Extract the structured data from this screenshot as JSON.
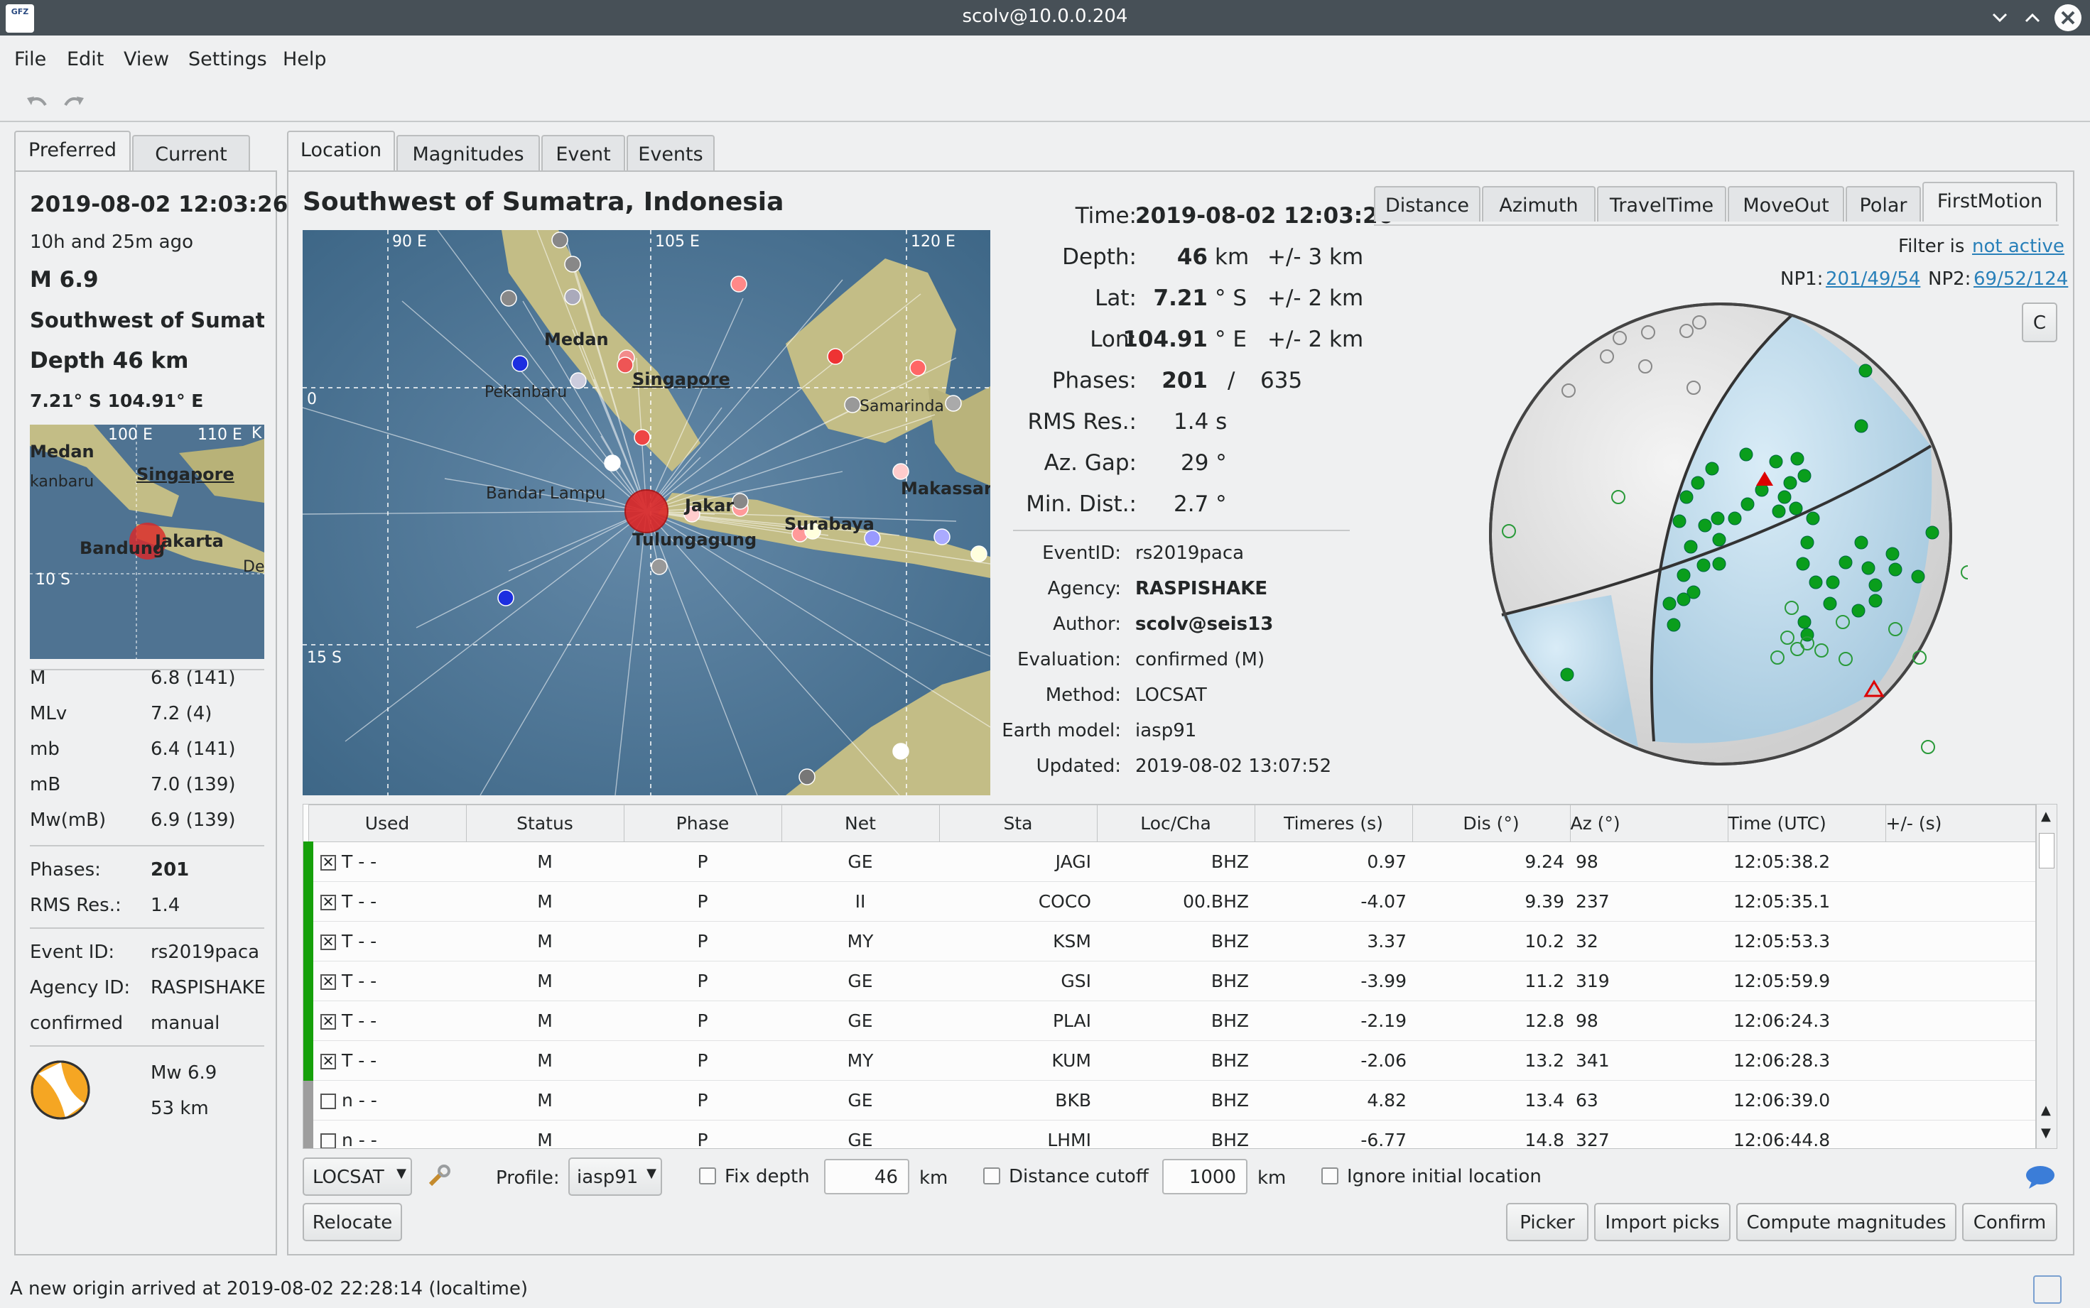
{
  "window": {
    "title": "scolv@10.0.0.204",
    "logo_text": "GFZ"
  },
  "menu": [
    "File",
    "Edit",
    "View",
    "Settings",
    "Help"
  ],
  "left_tabs": [
    "Preferred",
    "Current"
  ],
  "summary": {
    "time": "2019-08-02 12:03:26",
    "ago": "10h and 25m ago",
    "magnitude": "M 6.9",
    "region": "Southwest of Sumat",
    "depth": "Depth 46 km",
    "coords": "7.21° S  104.91° E",
    "map_labels": [
      "Medan",
      "Singapore",
      "kanbaru",
      "Bandung",
      "Jakarta",
      "100 E",
      "110 E",
      "10 S",
      "K",
      "De"
    ],
    "magnitudes": [
      {
        "type": "M",
        "value": "6.8 (141)"
      },
      {
        "type": "MLv",
        "value": "7.2 (4)"
      },
      {
        "type": "mb",
        "value": "6.4 (141)"
      },
      {
        "type": "mB",
        "value": "7.0 (139)"
      },
      {
        "type": "Mw(mB)",
        "value": "6.9 (139)"
      }
    ],
    "phases_label": "Phases:",
    "phases": "201",
    "rms_label": "RMS Res.:",
    "rms": "1.4",
    "event_id_label": "Event ID:",
    "event_id": "rs2019paca",
    "agency_label": "Agency ID:",
    "agency": "RASPISHAKE",
    "status": "confirmed",
    "mode": "manual",
    "mt_mag": "Mw 6.9",
    "mt_depth": "53 km"
  },
  "main_tabs": [
    "Location",
    "Magnitudes",
    "Event",
    "Events"
  ],
  "region_title": "Southwest of Sumatra, Indonesia",
  "map": {
    "labels": [
      "90 E",
      "105 E",
      "120 E",
      "0",
      "15 S",
      "Medan",
      "Pekanbaru",
      "Singapore",
      "Samarinda",
      "Makassar",
      "Bandar Lampu",
      "Jakar",
      "Tulungagung",
      "Surabaya"
    ]
  },
  "origin": {
    "time_label": "Time:",
    "time": "2019-08-02 12:03:26",
    "depth_label": "Depth:",
    "depth": "46",
    "depth_unit": "km",
    "depth_err": "+/- 3  km",
    "lat_label": "Lat:",
    "lat": "7.21",
    "lat_unit": "° S",
    "lat_err": "+/- 2  km",
    "lon_label": "Lon:",
    "lon": "104.91",
    "lon_unit": "° E",
    "lon_err": "+/- 2  km",
    "phases_label": "Phases:",
    "phases_used": "201",
    "phases_sep": "/",
    "phases_total": "635",
    "rms_label": "RMS Res.:",
    "rms": "1.4  s",
    "gap_label": "Az. Gap:",
    "gap": "29  °",
    "mindist_label": "Min. Dist.:",
    "mindist": "2.7  °",
    "eventid_label": "EventID:",
    "eventid": "rs2019paca",
    "agency_label": "Agency:",
    "agency": "RASPISHAKE",
    "author_label": "Author:",
    "author": "scolv@seis13",
    "evaluation_label": "Evaluation:",
    "evaluation": "confirmed (M)",
    "method_label": "Method:",
    "method": "LOCSAT",
    "earthmodel_label": "Earth model:",
    "earthmodel": "iasp91",
    "updated_label": "Updated:",
    "updated": "2019-08-02 13:07:52"
  },
  "plot_tabs": [
    "Distance",
    "Azimuth",
    "TravelTime",
    "MoveOut",
    "Polar",
    "FirstMotion"
  ],
  "filter": {
    "label": "Filter is",
    "value": "not active"
  },
  "nodal": {
    "np1_label": "NP1:",
    "np1": "201/49/54",
    "np2_label": "NP2:",
    "np2": "69/52/124"
  },
  "table": {
    "headers": [
      "Used",
      "Status",
      "Phase",
      "Net",
      "Sta",
      "Loc/Cha",
      "Timeres (s)",
      "Dis (°)",
      "Az (°)",
      "Time (UTC)",
      "+/- (s)"
    ],
    "rows": [
      {
        "flag": "T  -  -",
        "status": "M",
        "phase": "P",
        "net": "GE",
        "sta": "JAGI",
        "loccha": "BHZ",
        "res": "0.97",
        "dis": "9.24",
        "az": "98",
        "time": "12:05:38.2",
        "unc": ""
      },
      {
        "flag": "T  -  -",
        "status": "M",
        "phase": "P",
        "net": "II",
        "sta": "COCO",
        "loccha": "00.BHZ",
        "res": "-4.07",
        "dis": "9.39",
        "az": "237",
        "time": "12:05:35.1",
        "unc": ""
      },
      {
        "flag": "T  -  -",
        "status": "M",
        "phase": "P",
        "net": "MY",
        "sta": "KSM",
        "loccha": "BHZ",
        "res": "3.37",
        "dis": "10.2",
        "az": "32",
        "time": "12:05:53.3",
        "unc": ""
      },
      {
        "flag": "T  -  -",
        "status": "M",
        "phase": "P",
        "net": "GE",
        "sta": "GSI",
        "loccha": "BHZ",
        "res": "-3.99",
        "dis": "11.2",
        "az": "319",
        "time": "12:05:59.9",
        "unc": ""
      },
      {
        "flag": "T  -  -",
        "status": "M",
        "phase": "P",
        "net": "GE",
        "sta": "PLAI",
        "loccha": "BHZ",
        "res": "-2.19",
        "dis": "12.8",
        "az": "98",
        "time": "12:06:24.3",
        "unc": ""
      },
      {
        "flag": "T  -  -",
        "status": "M",
        "phase": "P",
        "net": "MY",
        "sta": "KUM",
        "loccha": "BHZ",
        "res": "-2.06",
        "dis": "13.2",
        "az": "341",
        "time": "12:06:28.3",
        "unc": ""
      },
      {
        "flag": "n  -  -",
        "status": "M",
        "phase": "P",
        "net": "GE",
        "sta": "BKB",
        "loccha": "BHZ",
        "res": "4.82",
        "dis": "13.4",
        "az": "63",
        "time": "12:06:39.0",
        "unc": ""
      },
      {
        "flag": "n  -  -",
        "status": "M",
        "phase": "P",
        "net": "GE",
        "sta": "LHMI",
        "loccha": "BHZ",
        "res": "-6.77",
        "dis": "14.8",
        "az": "327",
        "time": "12:06:44.8",
        "unc": ""
      }
    ]
  },
  "controls": {
    "locator": "LOCSAT",
    "profile_label": "Profile:",
    "profile": "iasp91",
    "fix_depth_label": "Fix depth",
    "fix_depth_value": "46",
    "km1": "km",
    "distance_cutoff_label": "Distance cutoff",
    "distance_cutoff_value": "1000",
    "km2": "km",
    "ignore_label": "Ignore initial location",
    "relocate": "Relocate",
    "picker": "Picker",
    "import_picks": "Import picks",
    "compute_magnitudes": "Compute magnitudes",
    "confirm": "Confirm",
    "c_button": "C"
  },
  "statusbar": "A new origin arrived at 2019-08-02 22:28:14 (localtime)"
}
